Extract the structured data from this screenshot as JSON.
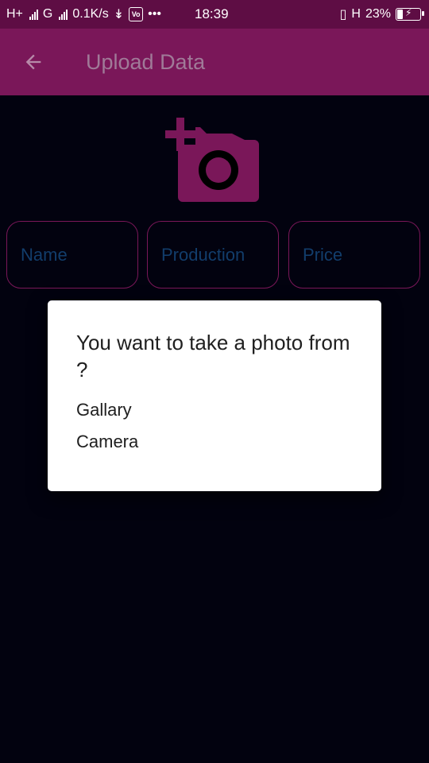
{
  "status_bar": {
    "network_1": "H+",
    "network_2": "G",
    "speed": "0.1K/s",
    "more": "•••",
    "time": "18:39",
    "network_3": "H",
    "battery": "23%"
  },
  "app_bar": {
    "title": "Upload Data",
    "back_icon": "arrow-back-icon"
  },
  "image_picker": {
    "icon": "add-a-photo-icon",
    "color": "#7a1759"
  },
  "fields": [
    {
      "placeholder": "Name"
    },
    {
      "placeholder": "Production"
    },
    {
      "placeholder": "Price"
    }
  ],
  "dialog": {
    "title": "You want to take a photo from ?",
    "options": [
      "Gallary",
      "Camera"
    ]
  },
  "colors": {
    "status_bar": "#5e0d44",
    "app_bar": "#7a1759",
    "background": "#02020f",
    "placeholder_text": "#123d6b",
    "dialog_bg": "#ffffff"
  }
}
